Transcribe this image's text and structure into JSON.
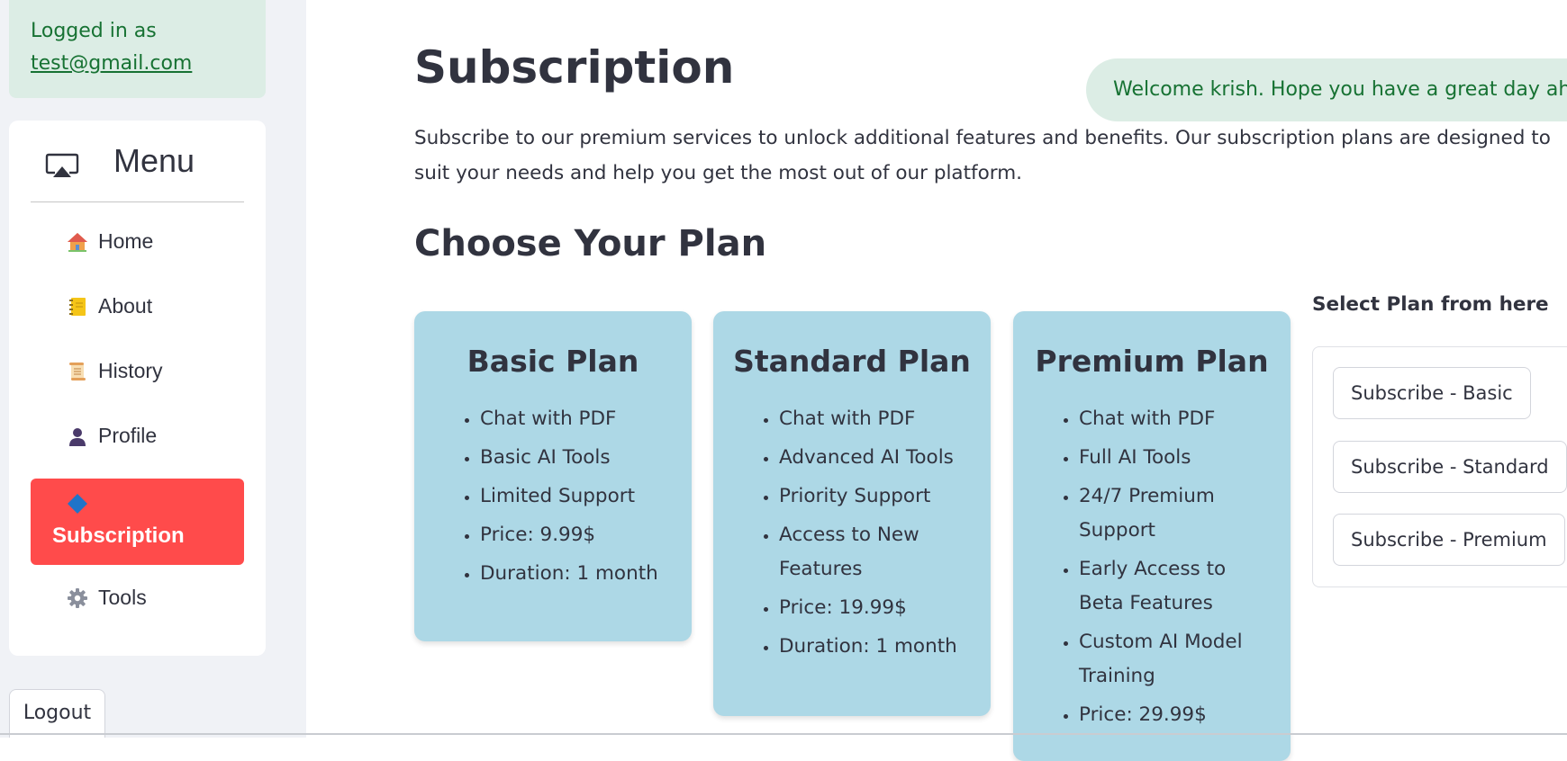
{
  "sidebar": {
    "login_prefix": "Logged in as",
    "login_email": "test@gmail.com",
    "menu_title": "Menu",
    "menu_icon": "screen-cast-icon",
    "items": [
      {
        "label": "Home",
        "icon": "house-icon"
      },
      {
        "label": "About",
        "icon": "notebook-icon"
      },
      {
        "label": "History",
        "icon": "scroll-icon"
      },
      {
        "label": "Profile",
        "icon": "user-silhouette-icon"
      },
      {
        "label": "Subscription",
        "icon": "blue-diamond-icon",
        "active": true
      },
      {
        "label": "Tools",
        "icon": "gear-icon"
      }
    ],
    "logout_label": "Logout"
  },
  "main": {
    "title": "Subscription",
    "toast": "Welcome krish. Hope you have a great day ahead!",
    "intro": "Subscribe to our premium services to unlock additional features and benefits. Our subscription plans are designed to suit your needs and help you get the most out of our platform.",
    "section_title": "Choose Your Plan",
    "plans": [
      {
        "name": "Basic Plan",
        "features": [
          "Chat with PDF",
          "Basic AI Tools",
          "Limited Support",
          "Price: 9.99$",
          "Duration: 1 month"
        ]
      },
      {
        "name": "Standard Plan",
        "features": [
          "Chat with PDF",
          "Advanced AI Tools",
          "Priority Support",
          "Access to New Features",
          "Price: 19.99$",
          "Duration: 1 month"
        ]
      },
      {
        "name": "Premium Plan",
        "features": [
          "Chat with PDF",
          "Full AI Tools",
          "24/7 Premium Support",
          "Early Access to Beta Features",
          "Custom AI Model Training",
          "Price: 29.99$"
        ]
      }
    ],
    "select_label": "Select Plan from here",
    "buttons": [
      "Subscribe - Basic",
      "Subscribe - Standard",
      "Subscribe - Premium"
    ]
  },
  "colors": {
    "accent": "#ff4b4b",
    "card": "#add8e6",
    "success_bg": "#dcede5",
    "success_text": "#177233"
  }
}
